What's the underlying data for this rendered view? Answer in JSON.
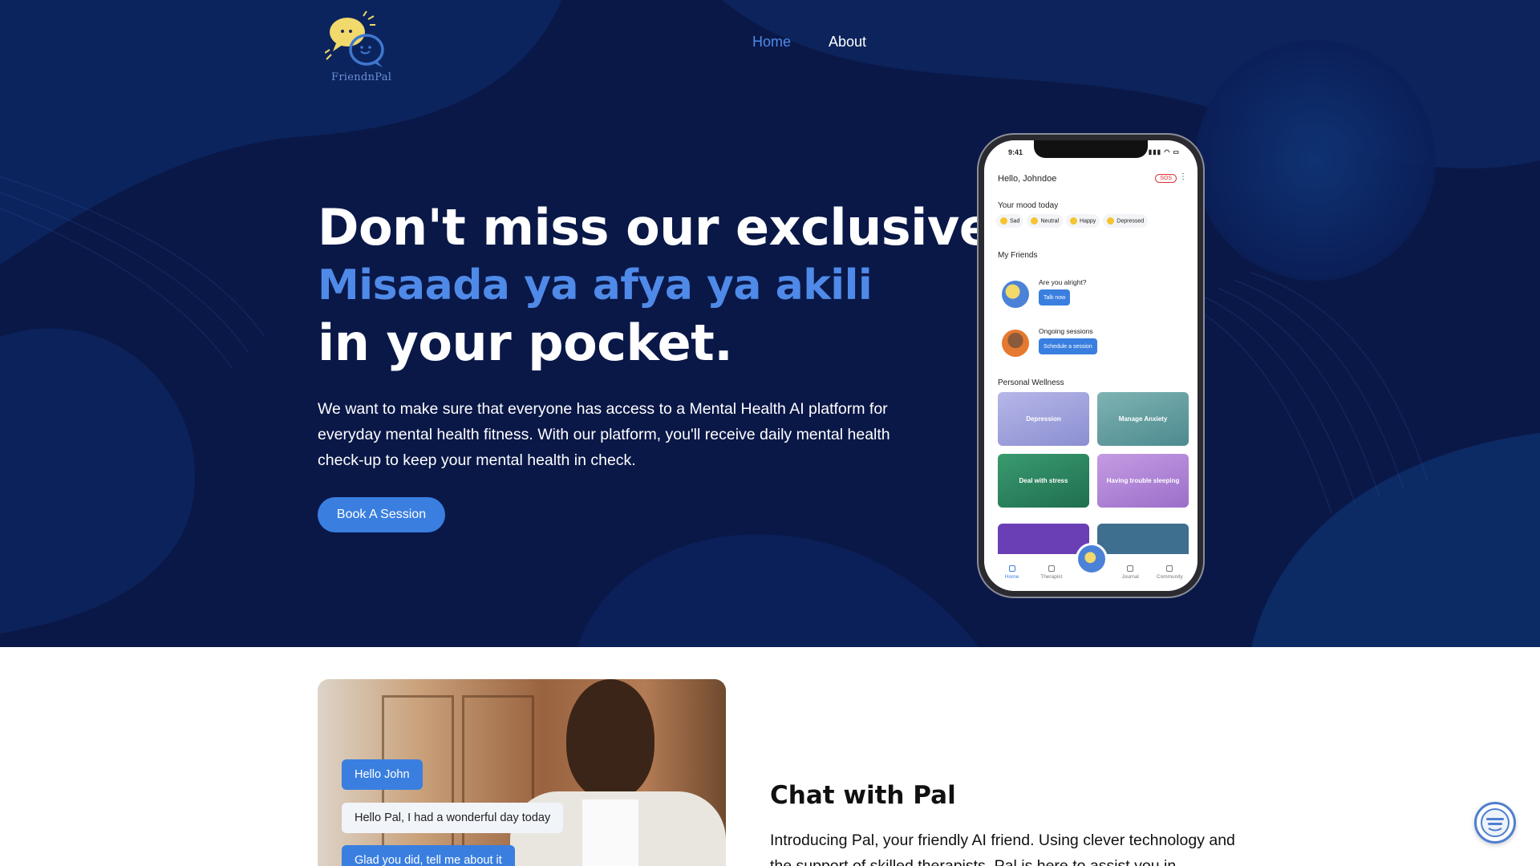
{
  "brand": {
    "name": "FriendnPal"
  },
  "nav": {
    "home": "Home",
    "about": "About"
  },
  "hero": {
    "line1": "Don't miss our exclusive",
    "line2": "Misaada ya afya ya akili",
    "line3": "in your pocket.",
    "description": "We want to make sure that everyone has access to a Mental Health AI platform for everyday mental health fitness. With our platform, you'll receive daily mental health check-up to keep your mental health in check.",
    "cta": "Book A Session"
  },
  "phone": {
    "time": "9:41",
    "greeting": "Hello, Johndoe",
    "sos": "SOS",
    "mood_title": "Your mood today",
    "moods": [
      "Sad",
      "Neutral",
      "Happy",
      "Depressed"
    ],
    "friends_title": "My Friends",
    "friend1_text": "Are you alright?",
    "friend1_button": "Talk now",
    "friend2_text": "Ongoing sessions",
    "friend2_button": "Schedule a session",
    "wellness_title": "Personal Wellness",
    "cards": [
      "Depression",
      "Manage Anxiety",
      "Deal with stress",
      "Having trouble sleeping"
    ],
    "tabs": [
      "Home",
      "Therapist",
      "Journal",
      "Community"
    ]
  },
  "chat_preview": {
    "bubble1": "Hello John",
    "bubble2": "Hello Pal, I had a wonderful day today",
    "bubble3": "Glad you did, tell me about it"
  },
  "chat_section": {
    "title": "Chat with Pal",
    "description": "Introducing Pal, your friendly AI friend. Using clever technology and the support of skilled therapists, Pal is here to assist you in"
  },
  "colors": {
    "hero_bg": "#0b1a4a",
    "accent": "#4f8ae8",
    "button": "#3a7fe0"
  },
  "icons": {
    "logo": "friendnpal-logo",
    "chat_widget": "chat-icon"
  }
}
